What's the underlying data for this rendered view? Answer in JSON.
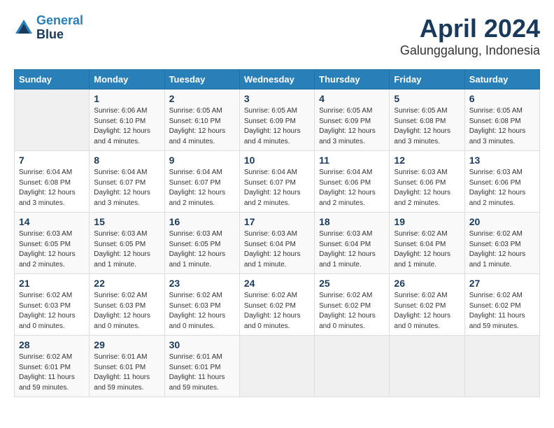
{
  "logo": {
    "line1": "General",
    "line2": "Blue"
  },
  "title": "April 2024",
  "subtitle": "Galunggalung, Indonesia",
  "headers": [
    "Sunday",
    "Monday",
    "Tuesday",
    "Wednesday",
    "Thursday",
    "Friday",
    "Saturday"
  ],
  "weeks": [
    [
      {
        "day": "",
        "info": ""
      },
      {
        "day": "1",
        "info": "Sunrise: 6:06 AM\nSunset: 6:10 PM\nDaylight: 12 hours\nand 4 minutes."
      },
      {
        "day": "2",
        "info": "Sunrise: 6:05 AM\nSunset: 6:10 PM\nDaylight: 12 hours\nand 4 minutes."
      },
      {
        "day": "3",
        "info": "Sunrise: 6:05 AM\nSunset: 6:09 PM\nDaylight: 12 hours\nand 4 minutes."
      },
      {
        "day": "4",
        "info": "Sunrise: 6:05 AM\nSunset: 6:09 PM\nDaylight: 12 hours\nand 3 minutes."
      },
      {
        "day": "5",
        "info": "Sunrise: 6:05 AM\nSunset: 6:08 PM\nDaylight: 12 hours\nand 3 minutes."
      },
      {
        "day": "6",
        "info": "Sunrise: 6:05 AM\nSunset: 6:08 PM\nDaylight: 12 hours\nand 3 minutes."
      }
    ],
    [
      {
        "day": "7",
        "info": "Sunrise: 6:04 AM\nSunset: 6:08 PM\nDaylight: 12 hours\nand 3 minutes."
      },
      {
        "day": "8",
        "info": "Sunrise: 6:04 AM\nSunset: 6:07 PM\nDaylight: 12 hours\nand 3 minutes."
      },
      {
        "day": "9",
        "info": "Sunrise: 6:04 AM\nSunset: 6:07 PM\nDaylight: 12 hours\nand 2 minutes."
      },
      {
        "day": "10",
        "info": "Sunrise: 6:04 AM\nSunset: 6:07 PM\nDaylight: 12 hours\nand 2 minutes."
      },
      {
        "day": "11",
        "info": "Sunrise: 6:04 AM\nSunset: 6:06 PM\nDaylight: 12 hours\nand 2 minutes."
      },
      {
        "day": "12",
        "info": "Sunrise: 6:03 AM\nSunset: 6:06 PM\nDaylight: 12 hours\nand 2 minutes."
      },
      {
        "day": "13",
        "info": "Sunrise: 6:03 AM\nSunset: 6:06 PM\nDaylight: 12 hours\nand 2 minutes."
      }
    ],
    [
      {
        "day": "14",
        "info": "Sunrise: 6:03 AM\nSunset: 6:05 PM\nDaylight: 12 hours\nand 2 minutes."
      },
      {
        "day": "15",
        "info": "Sunrise: 6:03 AM\nSunset: 6:05 PM\nDaylight: 12 hours\nand 1 minute."
      },
      {
        "day": "16",
        "info": "Sunrise: 6:03 AM\nSunset: 6:05 PM\nDaylight: 12 hours\nand 1 minute."
      },
      {
        "day": "17",
        "info": "Sunrise: 6:03 AM\nSunset: 6:04 PM\nDaylight: 12 hours\nand 1 minute."
      },
      {
        "day": "18",
        "info": "Sunrise: 6:03 AM\nSunset: 6:04 PM\nDaylight: 12 hours\nand 1 minute."
      },
      {
        "day": "19",
        "info": "Sunrise: 6:02 AM\nSunset: 6:04 PM\nDaylight: 12 hours\nand 1 minute."
      },
      {
        "day": "20",
        "info": "Sunrise: 6:02 AM\nSunset: 6:03 PM\nDaylight: 12 hours\nand 1 minute."
      }
    ],
    [
      {
        "day": "21",
        "info": "Sunrise: 6:02 AM\nSunset: 6:03 PM\nDaylight: 12 hours\nand 0 minutes."
      },
      {
        "day": "22",
        "info": "Sunrise: 6:02 AM\nSunset: 6:03 PM\nDaylight: 12 hours\nand 0 minutes."
      },
      {
        "day": "23",
        "info": "Sunrise: 6:02 AM\nSunset: 6:03 PM\nDaylight: 12 hours\nand 0 minutes."
      },
      {
        "day": "24",
        "info": "Sunrise: 6:02 AM\nSunset: 6:02 PM\nDaylight: 12 hours\nand 0 minutes."
      },
      {
        "day": "25",
        "info": "Sunrise: 6:02 AM\nSunset: 6:02 PM\nDaylight: 12 hours\nand 0 minutes."
      },
      {
        "day": "26",
        "info": "Sunrise: 6:02 AM\nSunset: 6:02 PM\nDaylight: 12 hours\nand 0 minutes."
      },
      {
        "day": "27",
        "info": "Sunrise: 6:02 AM\nSunset: 6:02 PM\nDaylight: 11 hours\nand 59 minutes."
      }
    ],
    [
      {
        "day": "28",
        "info": "Sunrise: 6:02 AM\nSunset: 6:01 PM\nDaylight: 11 hours\nand 59 minutes."
      },
      {
        "day": "29",
        "info": "Sunrise: 6:01 AM\nSunset: 6:01 PM\nDaylight: 11 hours\nand 59 minutes."
      },
      {
        "day": "30",
        "info": "Sunrise: 6:01 AM\nSunset: 6:01 PM\nDaylight: 11 hours\nand 59 minutes."
      },
      {
        "day": "",
        "info": ""
      },
      {
        "day": "",
        "info": ""
      },
      {
        "day": "",
        "info": ""
      },
      {
        "day": "",
        "info": ""
      }
    ]
  ]
}
